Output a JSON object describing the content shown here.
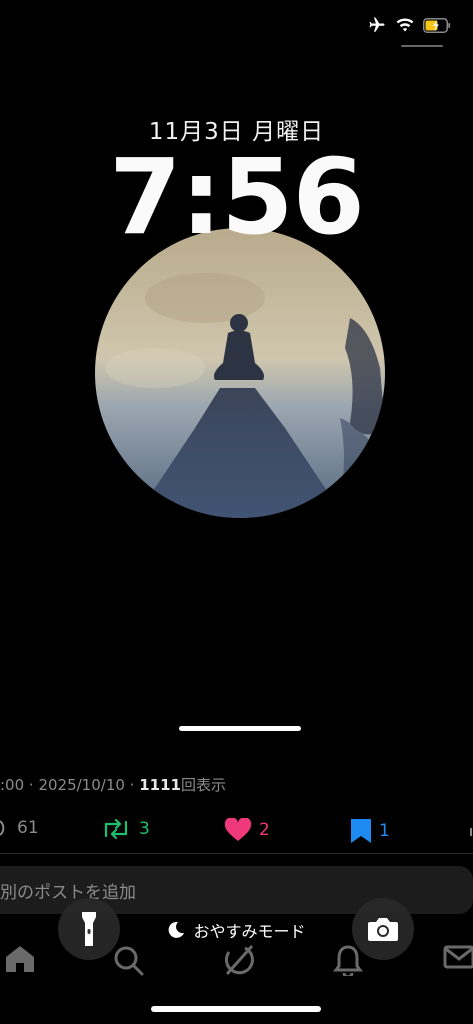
{
  "status_bar": {
    "icons": [
      "airplane-icon",
      "wifi-icon",
      "battery-charging-icon"
    ],
    "battery_color": "#f5c518"
  },
  "lock_screen": {
    "date": "11月3日 月曜日",
    "time": "7:56",
    "photo": "shadow-on-sand-photo"
  },
  "tweet": {
    "time_prefix": ":00",
    "sep1": " · ",
    "date": "2025/10/10",
    "sep2": " · ",
    "views": "1111",
    "views_label": "回表示",
    "replies": "61",
    "retweets": "3",
    "likes": "2",
    "bookmarks": "1",
    "colors": {
      "retweet": "#1fbf6e",
      "like": "#f0397a",
      "bookmark": "#1d8bf1"
    },
    "composer_placeholder": "別のポストを追加"
  },
  "controls": {
    "sleep_mode_label": "おやすみモード"
  },
  "tabs": [
    "home-icon",
    "search-icon",
    "grok-icon",
    "notifications-icon",
    "messages-icon"
  ]
}
